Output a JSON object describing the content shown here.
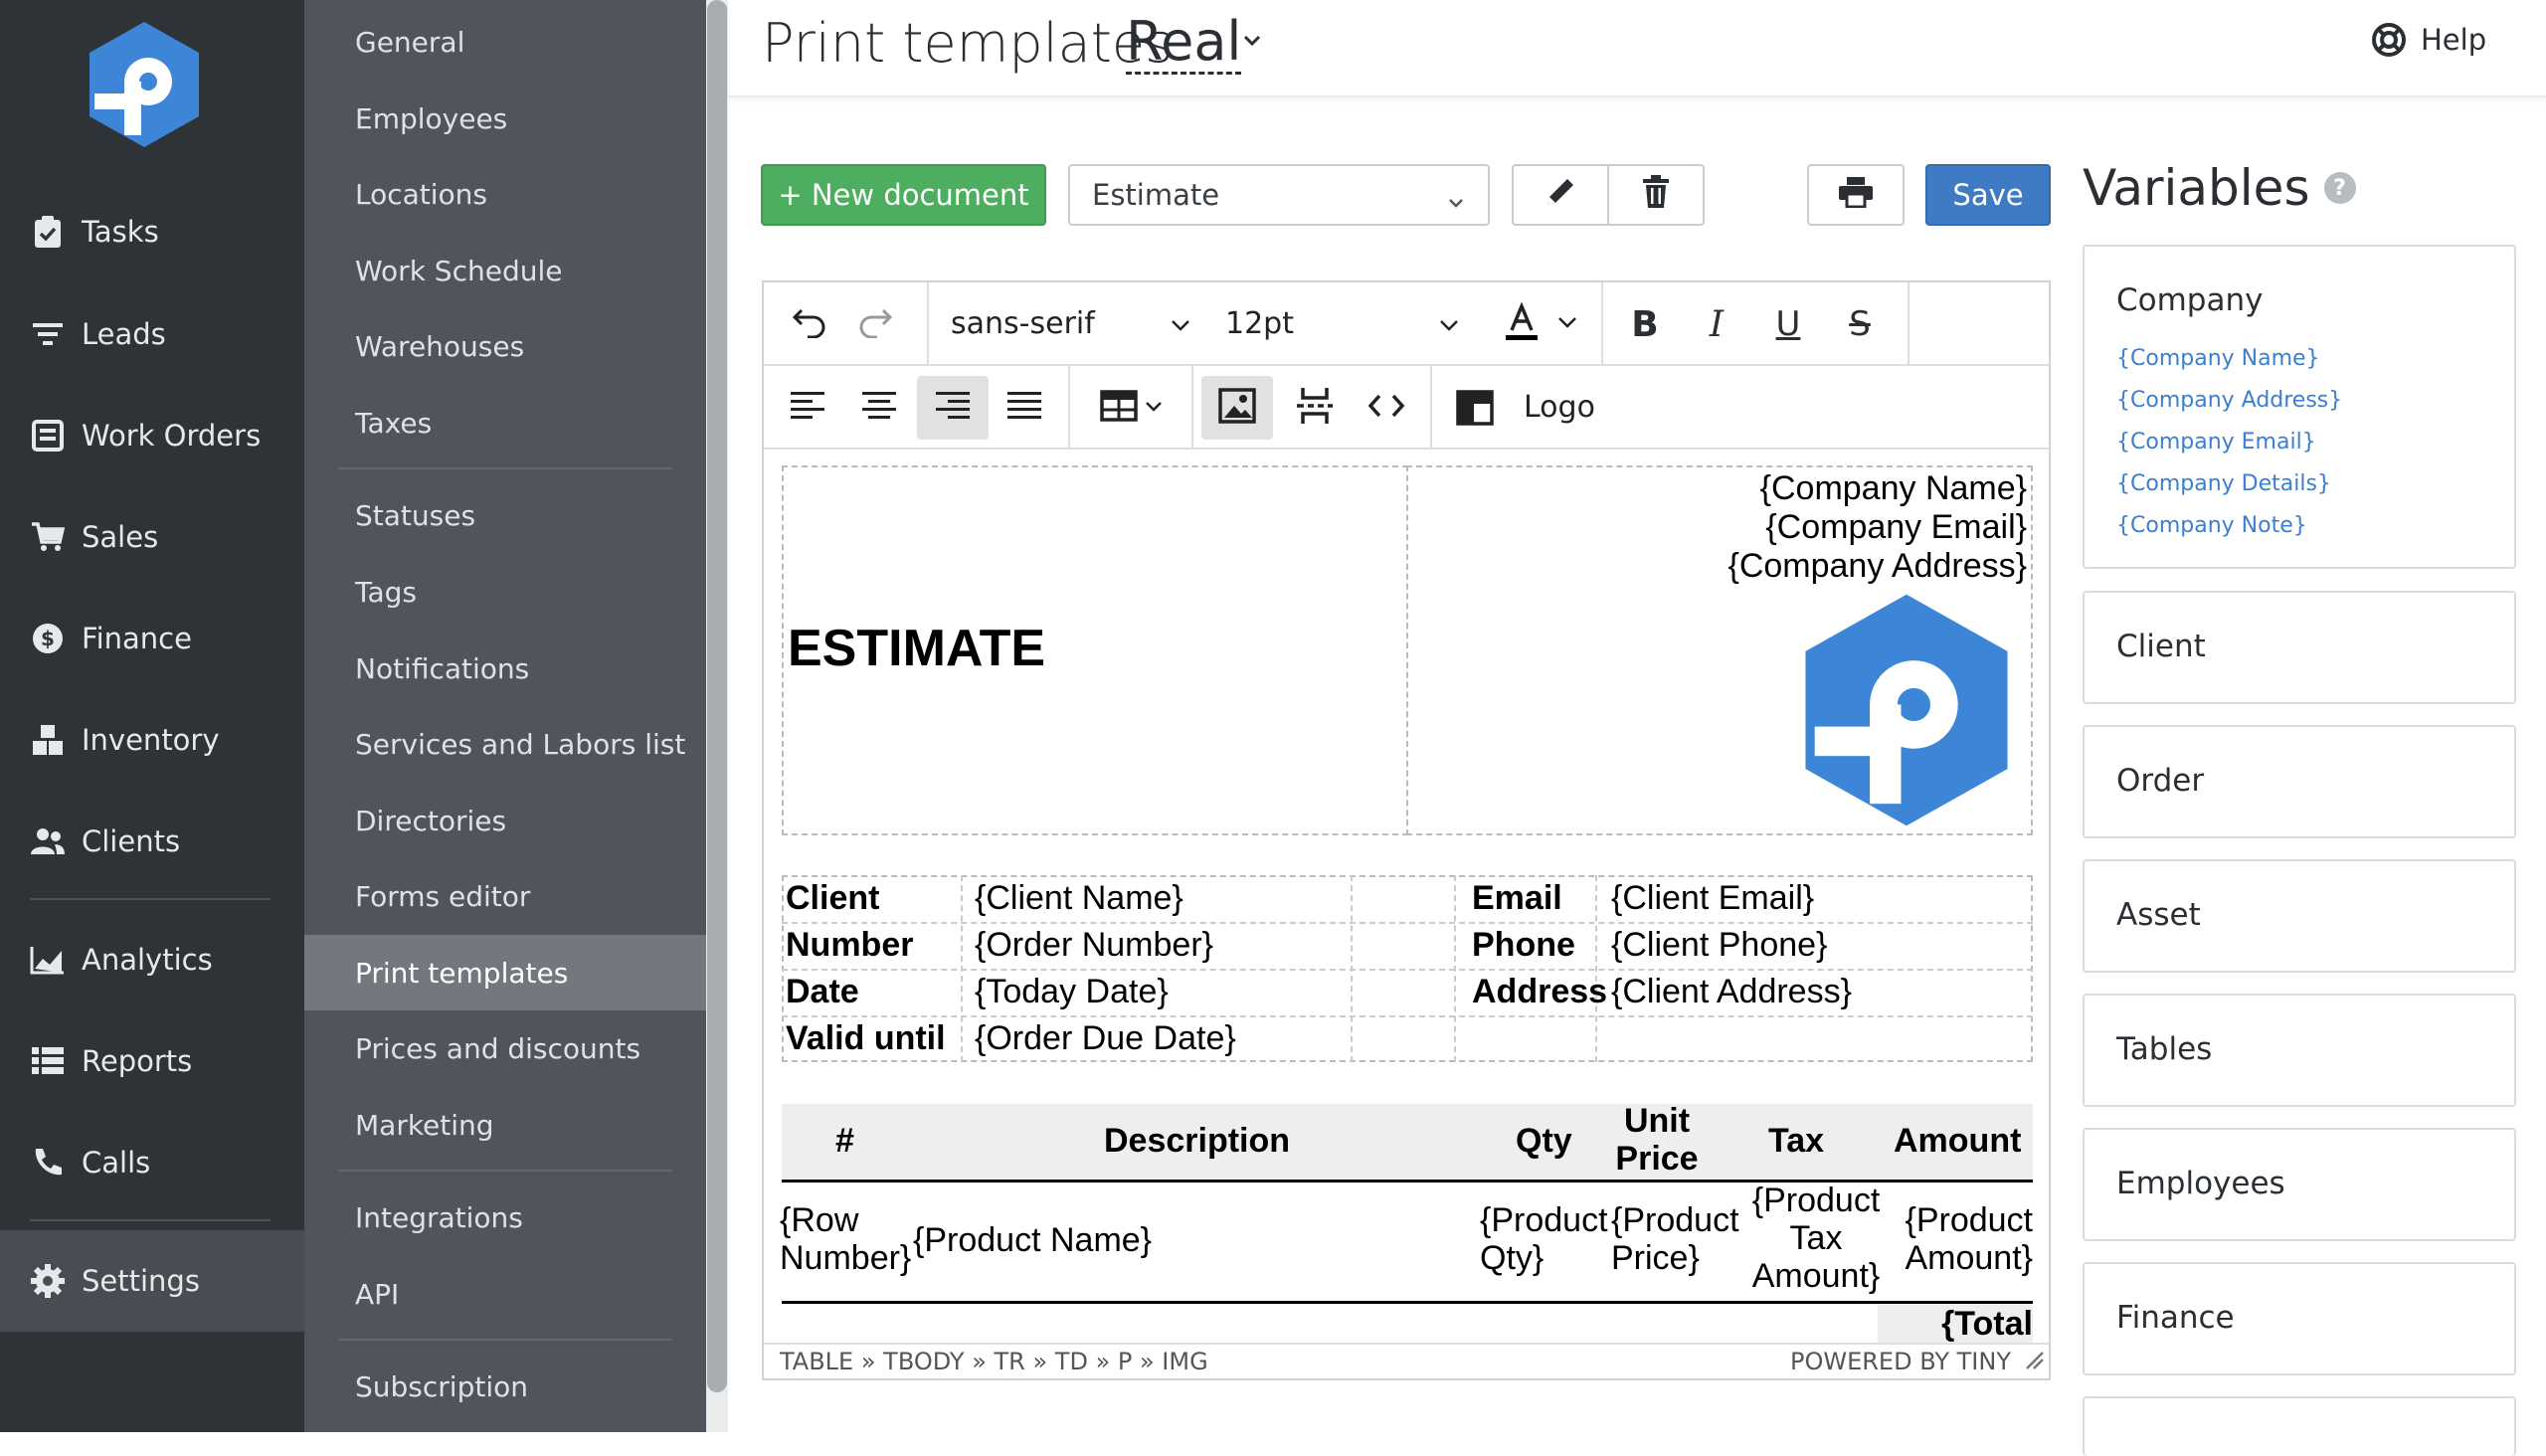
{
  "nav": {
    "items": [
      {
        "label": "Tasks",
        "icon": "clipboard-check-icon"
      },
      {
        "label": "Leads",
        "icon": "filter-icon"
      },
      {
        "label": "Work Orders",
        "icon": "work-order-icon"
      },
      {
        "label": "Sales",
        "icon": "cart-icon"
      },
      {
        "label": "Finance",
        "icon": "dollar-coin-icon"
      },
      {
        "label": "Inventory",
        "icon": "boxes-icon"
      },
      {
        "label": "Clients",
        "icon": "users-icon"
      },
      {
        "label": "Analytics",
        "icon": "area-chart-icon"
      },
      {
        "label": "Reports",
        "icon": "list-icon"
      },
      {
        "label": "Calls",
        "icon": "phone-icon"
      },
      {
        "label": "Settings",
        "icon": "gear-icon"
      }
    ],
    "active": "Settings"
  },
  "settings_menu": {
    "items": [
      "General",
      "Employees",
      "Locations",
      "Work Schedule",
      "Warehouses",
      "Taxes",
      "Statuses",
      "Tags",
      "Notifications",
      "Services and Labors list",
      "Directories",
      "Forms editor",
      "Print templates",
      "Prices and discounts",
      "Marketing",
      "Integrations",
      "API",
      "Subscription"
    ],
    "active": "Print templates"
  },
  "header": {
    "title": "Print templates",
    "selected": "Real",
    "help_label": "Help"
  },
  "toolbar": {
    "new_document_label": "+ New document",
    "document_type": "Estimate",
    "save_label": "Save"
  },
  "editor": {
    "font_family": "sans-serif",
    "font_size": "12pt",
    "logo_label": "Logo",
    "statusbar_path": "TABLE » TBODY » TR » TD » P » IMG",
    "powered_by": "POWERED BY TINY"
  },
  "document": {
    "heading": "ESTIMATE",
    "company_lines": [
      "{Company Name}",
      "{Company Email}",
      "{Company Address}"
    ],
    "info_rows": [
      {
        "label": "Client",
        "value": "{Client Name}",
        "label2": "Email",
        "value2": "{Client Email}"
      },
      {
        "label": "Number",
        "value": "{Order Number}",
        "label2": "Phone",
        "value2": "{Client Phone}"
      },
      {
        "label": "Date",
        "value": "{Today Date}",
        "label2": "Address",
        "value2": "{Client Address}"
      },
      {
        "label": "Valid until",
        "value": "{Order Due Date}",
        "label2": "",
        "value2": ""
      }
    ],
    "items_headers": {
      "num": "#",
      "desc": "Description",
      "qty": "Qty",
      "unit1": "Unit",
      "unit2": "Price",
      "tax": "Tax",
      "amount": "Amount"
    },
    "items_row": {
      "num1": "{Row",
      "num2": "Number}",
      "desc": "{Product Name}",
      "qty1": "{Product",
      "qty2": "Qty}",
      "price1": "{Product",
      "price2": "Price}",
      "tax1": "{Product",
      "tax2": "Tax",
      "tax3": "Amount}",
      "amt1": "{Product",
      "amt2": "Amount}"
    },
    "total": "{Total"
  },
  "variables": {
    "title": "Variables",
    "company": {
      "label": "Company",
      "items": [
        "{Company Name}",
        "{Company Address}",
        "{Company Email}",
        "{Company Details}",
        "{Company Note}"
      ]
    },
    "sections": [
      "Client",
      "Order",
      "Asset",
      "Tables",
      "Employees",
      "Finance"
    ]
  },
  "colors": {
    "accent_blue": "#3e7bc4",
    "green": "#4cae5e",
    "logo_blue": "#3d85d6",
    "nav_bg": "#2e3338",
    "submenu_bg": "#4f555b"
  }
}
